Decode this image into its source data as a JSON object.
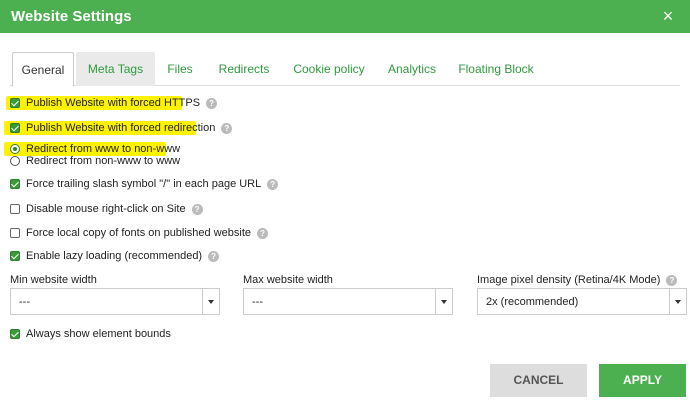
{
  "window": {
    "title": "Website Settings",
    "close_icon": "×"
  },
  "tabs": [
    "General",
    "Meta Tags",
    "Files",
    "Redirects",
    "Cookie policy",
    "Analytics",
    "Floating Block"
  ],
  "options": {
    "force_https": "Publish Website with forced HTTPS",
    "forced_redirection": "Publish Website with forced redirection",
    "redirect_www_to_nonwww": "Redirect from www to non-www",
    "redirect_nonwww_to_www": "Redirect from non-www to www",
    "trailing_slash": "Force trailing slash symbol \"/\" in each page URL",
    "disable_right_click": "Disable mouse right-click on Site",
    "local_fonts": "Force local copy of fonts on published website",
    "lazy_loading": "Enable lazy loading (recommended)",
    "element_bounds": "Always show element bounds"
  },
  "fields": {
    "min_width_label": "Min website width",
    "min_width_value": "---",
    "max_width_label": "Max website width",
    "max_width_value": "---",
    "pixel_density_label": "Image pixel density (Retina/4K Mode)",
    "pixel_density_value": "2x (recommended)"
  },
  "help_glyph": "?",
  "buttons": {
    "cancel": "CANCEL",
    "apply": "APPLY"
  },
  "colors": {
    "accent": "#4caf50",
    "highlight": "#fff200",
    "tab_link": "#2e9a3e"
  }
}
